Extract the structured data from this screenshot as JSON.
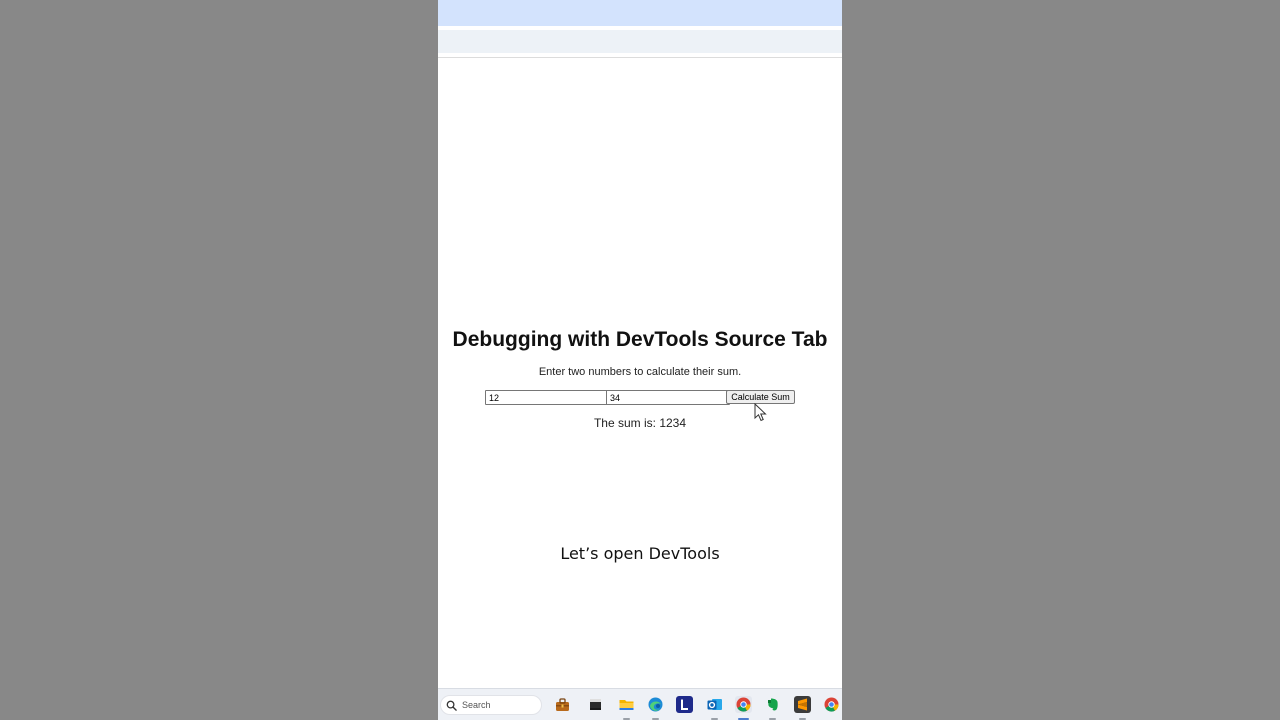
{
  "page": {
    "title": "Debugging with DevTools Source Tab",
    "instructions": "Enter two numbers to calculate their sum.",
    "input_a_value": "12",
    "input_b_value": "34",
    "calculate_label": "Calculate Sum",
    "result_text": "The sum is: 1234"
  },
  "caption": "Let’s open DevTools",
  "taskbar": {
    "search_label": "Search",
    "icons": [
      "toolbox-icon",
      "terminal-icon",
      "file-explorer-icon",
      "edge-icon",
      "launcher-l-icon",
      "outlook-icon",
      "chrome-icon",
      "evernote-icon",
      "sublime-text-icon",
      "chrome-icon"
    ]
  },
  "colors": {
    "backdrop": "#888888",
    "tab_strip": "#d3e3fd",
    "toolbar": "#edf2f7",
    "taskbar": "#eef1f6"
  }
}
